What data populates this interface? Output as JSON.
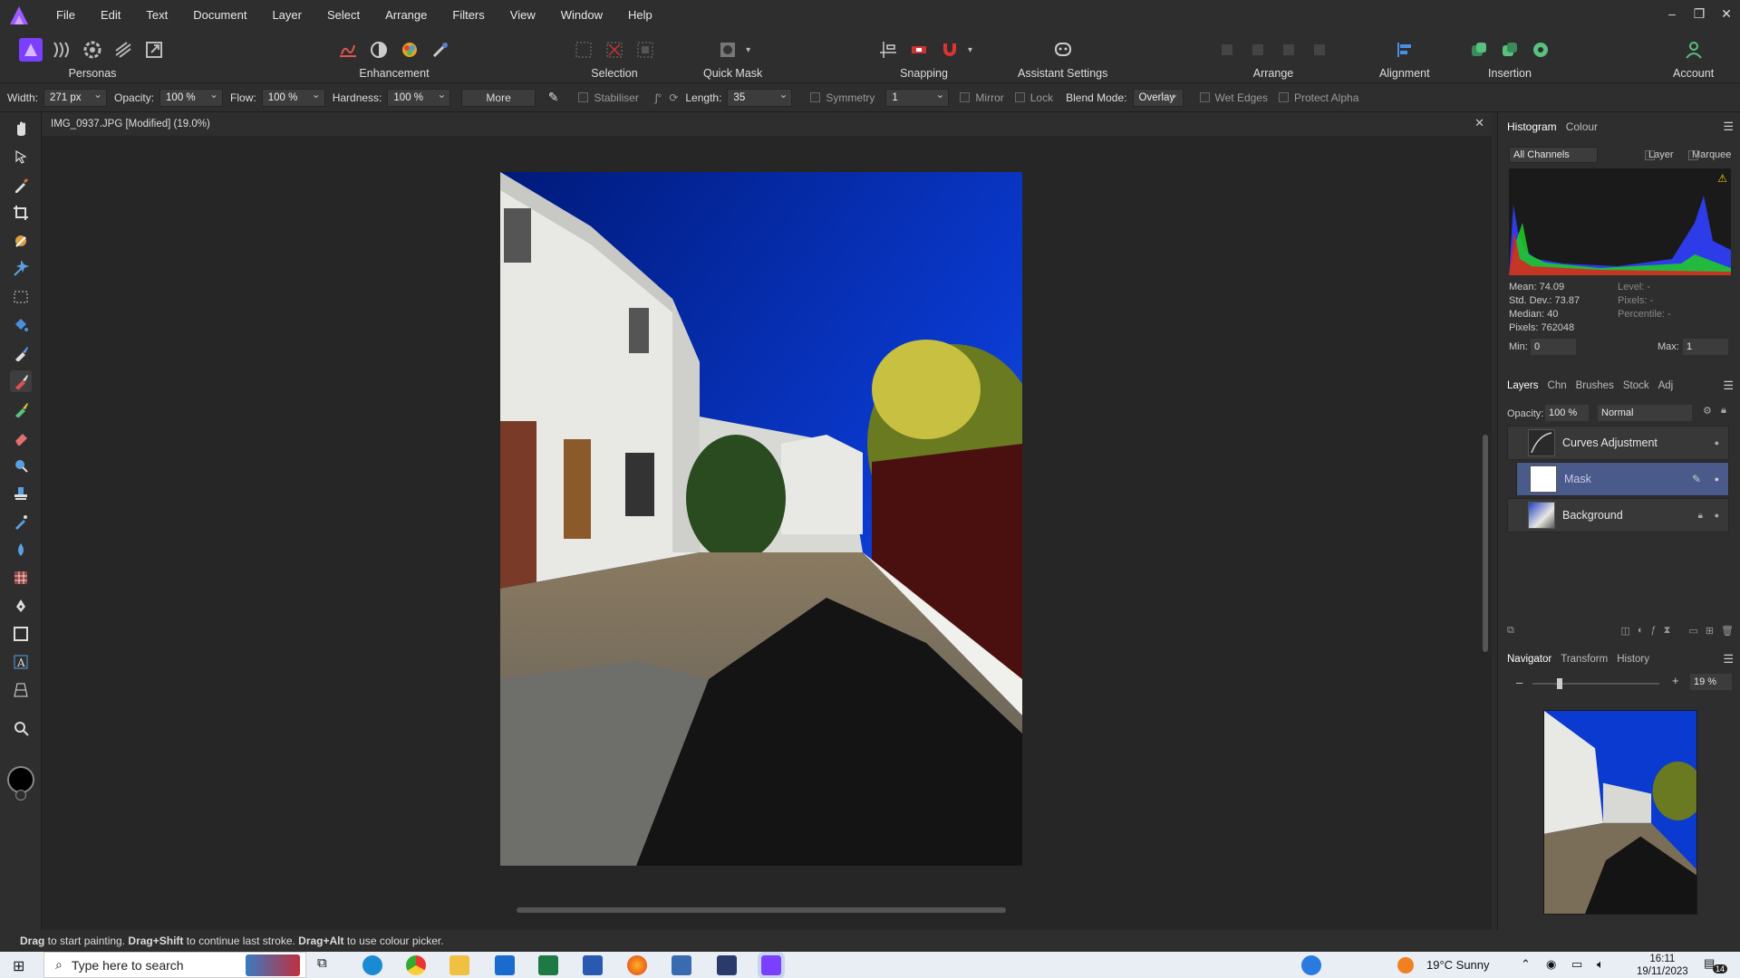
{
  "menubar": {
    "items": [
      "File",
      "Edit",
      "Text",
      "Document",
      "Layer",
      "Select",
      "Arrange",
      "Filters",
      "View",
      "Window",
      "Help"
    ]
  },
  "toolbar": {
    "personas": "Personas",
    "enhancement": "Enhancement",
    "selection": "Selection",
    "quick_mask": "Quick Mask",
    "snapping": "Snapping",
    "assistant": "Assistant Settings",
    "arrange": "Arrange",
    "alignment": "Alignment",
    "insertion": "Insertion",
    "account": "Account"
  },
  "context": {
    "width_label": "Width:",
    "width_value": "271 px",
    "opacity_label": "Opacity:",
    "opacity_value": "100 %",
    "flow_label": "Flow:",
    "flow_value": "100 %",
    "hardness_label": "Hardness:",
    "hardness_value": "100 %",
    "more": "More",
    "stabiliser": "Stabiliser",
    "length_label": "Length:",
    "length_value": "35",
    "symmetry": "Symmetry",
    "symmetry_value": "1",
    "mirror": "Mirror",
    "lock": "Lock",
    "blend_label": "Blend Mode:",
    "blend_value": "Overlay",
    "wet_edges": "Wet Edges",
    "protect_alpha": "Protect Alpha"
  },
  "document": {
    "tab_title": "IMG_0937.JPG [Modified] (19.0%)"
  },
  "histogram": {
    "tabs": [
      "Histogram",
      "Colour"
    ],
    "channel": "All Channels",
    "layer": "Layer",
    "marquee": "Marquee",
    "mean": "Mean: 74.09",
    "std": "Std. Dev.: 73.87",
    "median": "Median: 40",
    "pixels": "Pixels: 762048",
    "level": "Level: -",
    "pixels_r": "Pixels: -",
    "percentile": "Percentile: -",
    "min_label": "Min:",
    "min_value": "0",
    "max_label": "Max:",
    "max_value": "1"
  },
  "layers": {
    "tabs": [
      "Layers",
      "Chn",
      "Brushes",
      "Stock",
      "Adj"
    ],
    "opacity_label": "Opacity:",
    "opacity_value": "100 %",
    "blend": "Normal",
    "items": [
      "Curves Adjustment",
      "Mask",
      "Background"
    ]
  },
  "navigator": {
    "tabs": [
      "Navigator",
      "Transform",
      "History"
    ],
    "zoom": "19 %",
    "zoom_fraction": 0.19
  },
  "status": {
    "drag1": "Drag",
    "t1": " to start painting. ",
    "drag2": "Drag+Shift",
    "t2": " to continue last stroke. ",
    "drag3": "Drag+Alt",
    "t3": " to use colour picker."
  },
  "taskbar": {
    "search": "Type here to search",
    "weather": "19°C  Sunny",
    "time": "16:11",
    "date": "19/11/2023",
    "notif": "14"
  },
  "colors": {
    "accent": "#7a3fff",
    "selected_layer": "#4a5a8a",
    "taskbar": "#e9eef5"
  }
}
